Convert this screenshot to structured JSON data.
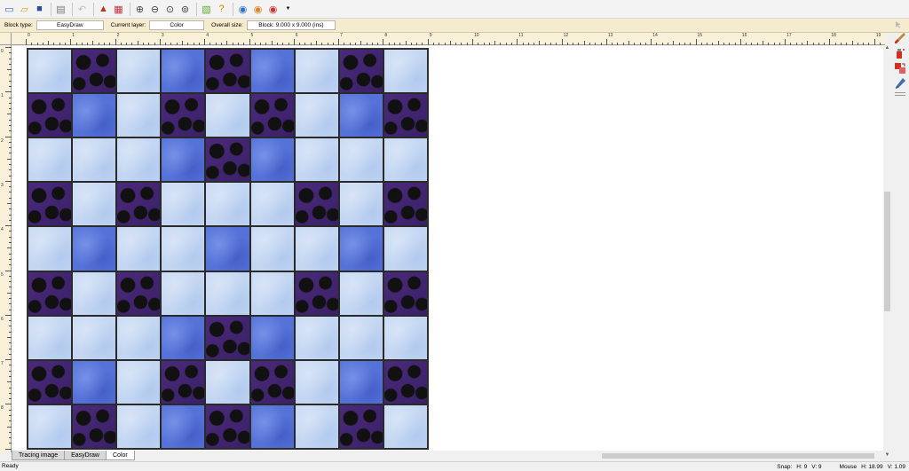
{
  "toolbar": {
    "icons": [
      "new-block-icon",
      "open-icon",
      "save-icon",
      "print-icon",
      "undo-icon",
      "add-to-sketchbook-icon",
      "view-sketchbook-icon",
      "zoom-in-icon",
      "zoom-out-icon",
      "zoom-fit-icon",
      "zoom-refresh-icon",
      "block-worktable-icon",
      "help-icon",
      "easydraw-icon",
      "fabric-icon",
      "color-icon"
    ]
  },
  "infobar": {
    "block_type_label": "Block type:",
    "block_type_value": "EasyDraw",
    "current_layer_label": "Current layer:",
    "current_layer_value": "Color",
    "overall_size_label": "Overall size:",
    "overall_size_value": "Block: 9.000 x 9.000 (ins)"
  },
  "ruler": {
    "h_numbers": [
      "0",
      "1",
      "2",
      "3",
      "4",
      "5",
      "6",
      "7",
      "8",
      "9",
      "10",
      "11",
      "12",
      "13",
      "14",
      "15",
      "16",
      "17",
      "18",
      "19"
    ],
    "v_numbers": [
      "0",
      "1",
      "2",
      "3",
      "4",
      "5",
      "6",
      "7",
      "8",
      "9"
    ]
  },
  "fabrics": {
    "L": "#c3d6f2",
    "D": "#2c1d45",
    "M": "#5572d8"
  },
  "quilt_grid": [
    [
      "L",
      "D",
      "L",
      "M",
      "D",
      "M",
      "L",
      "D",
      "L"
    ],
    [
      "D",
      "M",
      "L",
      "D",
      "L",
      "D",
      "L",
      "M",
      "D"
    ],
    [
      "L",
      "L",
      "L",
      "M",
      "D",
      "M",
      "L",
      "L",
      "L"
    ],
    [
      "D",
      "L",
      "D",
      "L",
      "L",
      "L",
      "D",
      "L",
      "D"
    ],
    [
      "L",
      "M",
      "L",
      "L",
      "M",
      "L",
      "L",
      "M",
      "L"
    ],
    [
      "D",
      "L",
      "D",
      "L",
      "L",
      "L",
      "D",
      "L",
      "D"
    ],
    [
      "L",
      "L",
      "L",
      "M",
      "D",
      "M",
      "L",
      "L",
      "L"
    ],
    [
      "D",
      "M",
      "L",
      "D",
      "L",
      "D",
      "L",
      "M",
      "D"
    ],
    [
      "L",
      "D",
      "L",
      "M",
      "D",
      "M",
      "L",
      "D",
      "L"
    ]
  ],
  "tabs": [
    {
      "label": "Tracing image",
      "active": false
    },
    {
      "label": "EasyDraw",
      "active": false
    },
    {
      "label": "Color",
      "active": true
    }
  ],
  "status": {
    "left": "Ready",
    "snap_label": "Snap:",
    "snap_h": "H: 9",
    "snap_v": "V: 9",
    "mouse_label": "Mouse",
    "mouse_h": "H: 18.99",
    "mouse_v": "V: 1.09"
  },
  "right_tools": [
    "paintbrush-icon",
    "spraycan-icon",
    "swap-color-icon",
    "eyedropper-icon"
  ]
}
